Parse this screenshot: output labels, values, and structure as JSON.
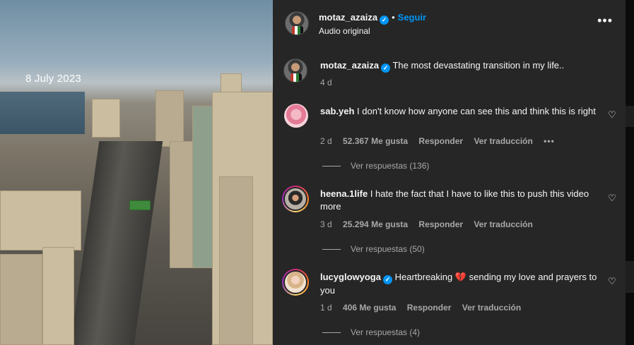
{
  "media": {
    "overlay_date": "8 July 2023"
  },
  "header": {
    "username": "motaz_azaiza",
    "verified_icon": "verified-badge-icon",
    "separator": "•",
    "follow_label": "Seguir",
    "audio_label": "Audio original",
    "more_icon": "more-horizontal-icon"
  },
  "caption": {
    "username": "motaz_azaiza",
    "text": "The most devastating transition in my life..",
    "time": "4 d"
  },
  "comments": [
    {
      "username": "sab.yeh",
      "text": "I don't know how anyone can see this and think this is right",
      "time": "2 d",
      "likes": "52.367 Me gusta",
      "reply_label": "Responder",
      "translate_label": "Ver traducción",
      "options": "•••",
      "view_replies": "Ver respuestas (136)"
    },
    {
      "username": "heena.1life",
      "text": "I hate the fact that I have to like this to push this video more",
      "time": "3 d",
      "likes": "25.294 Me gusta",
      "reply_label": "Responder",
      "translate_label": "Ver traducción",
      "view_replies": "Ver respuestas (50)"
    },
    {
      "username": "lucyglowyoga",
      "text": "Heartbreaking 💔 sending my love and prayers to you",
      "time": "1 d",
      "likes": "406 Me gusta",
      "reply_label": "Responder",
      "translate_label": "Ver traducción",
      "view_replies": "Ver respuestas (4)"
    }
  ],
  "colors": {
    "panel_bg": "#262626",
    "accent": "#0095f6",
    "muted": "#a8a8a8"
  }
}
